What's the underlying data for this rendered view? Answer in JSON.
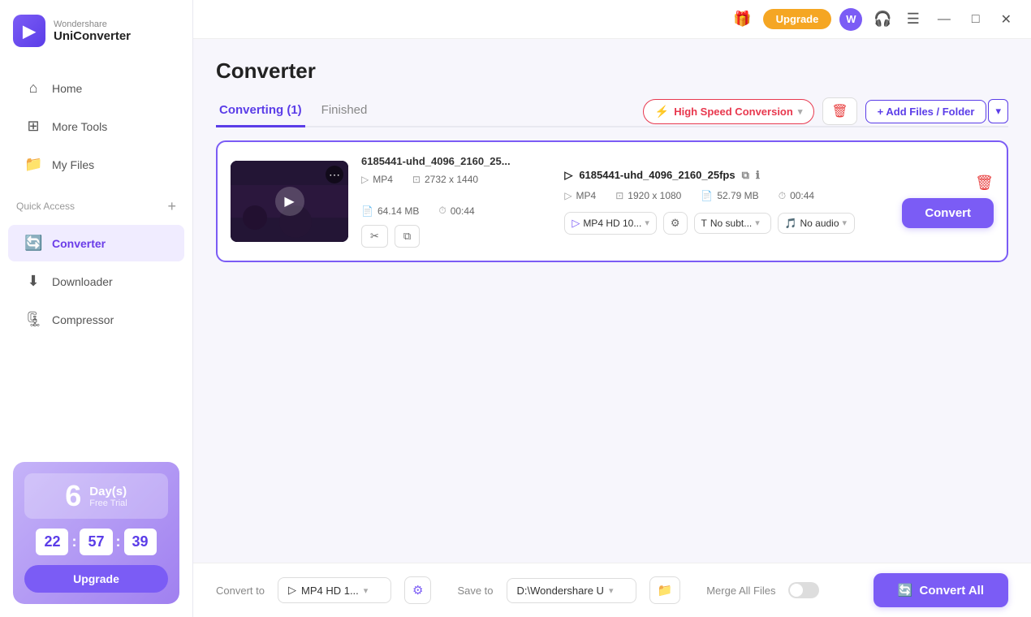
{
  "app": {
    "brand": "Wondershare",
    "product": "UniConverter",
    "logo_letter": "▶"
  },
  "titlebar": {
    "upgrade_label": "Upgrade",
    "avatar_letter": "W",
    "icons": {
      "gift": "🎁",
      "headset": "🎧",
      "menu": "☰",
      "minimize": "—",
      "maximize": "□",
      "close": "✕"
    }
  },
  "sidebar": {
    "nav_items": [
      {
        "id": "home",
        "label": "Home",
        "icon": "⌂"
      },
      {
        "id": "more-tools",
        "label": "More Tools",
        "icon": "⊞"
      },
      {
        "id": "my-files",
        "label": "My Files",
        "icon": "📁"
      }
    ],
    "quick_access_label": "Quick Access",
    "quick_access_add": "+",
    "active_items": [
      {
        "id": "converter",
        "label": "Converter",
        "icon": "🔄"
      }
    ],
    "other_items": [
      {
        "id": "downloader",
        "label": "Downloader",
        "icon": "⬇"
      },
      {
        "id": "compressor",
        "label": "Compressor",
        "icon": "🗜"
      }
    ],
    "trial": {
      "days_num": "6",
      "days_label": "Day(s)",
      "free_trial": "Free Trial",
      "hours": "22",
      "minutes": "57",
      "seconds": "39",
      "upgrade_label": "Upgrade"
    }
  },
  "page": {
    "title": "Converter",
    "tabs": [
      {
        "id": "converting",
        "label": "Converting (1)",
        "active": true
      },
      {
        "id": "finished",
        "label": "Finished",
        "active": false
      }
    ],
    "toolbar": {
      "speed_label": "High Speed Conversion",
      "delete_icon": "🗑",
      "add_files_label": "+ Add Files / Folder",
      "add_files_chevron": "▾"
    }
  },
  "file_card": {
    "source_name": "6185441-uhd_4096_2160_25...",
    "source_format": "MP4",
    "source_resolution": "2732 x 1440",
    "source_size": "64.14 MB",
    "source_duration": "00:44",
    "output_name": "6185441-uhd_4096_2160_25fps",
    "output_format": "MP4",
    "output_resolution": "1920 x 1080",
    "output_size": "52.79 MB",
    "output_duration": "00:44",
    "format_select": "MP4 HD 10...",
    "subtitle_select": "No subt...",
    "audio_select": "No audio",
    "convert_btn_label": "Convert"
  },
  "bottom_bar": {
    "convert_to_label": "Convert to",
    "convert_to_value": "MP4 HD 1...",
    "save_to_label": "Save to",
    "save_to_value": "D:\\Wondershare U",
    "merge_label": "Merge All Files",
    "convert_all_label": "Convert All"
  }
}
